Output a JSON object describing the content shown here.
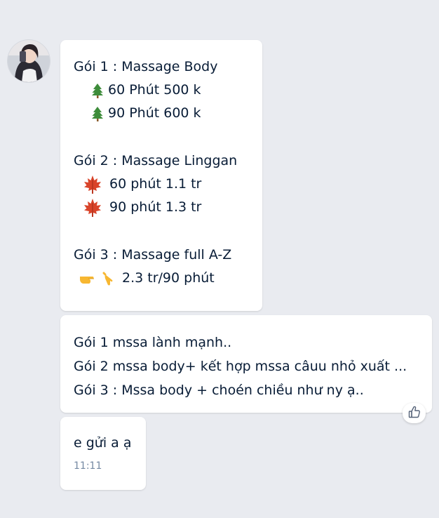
{
  "contact": {
    "avatar_icon": "contact-avatar"
  },
  "messages": [
    {
      "lines": [
        {
          "text": "Gói 1 : Massage Body"
        },
        {
          "icon": "pine-tree-emoji",
          "text": "60 Phút 500 k"
        },
        {
          "icon": "pine-tree-emoji",
          "text": "90 Phút 600 k"
        },
        {
          "text": "Gói 2 : Massage Linggan"
        },
        {
          "icon": "maple-leaf-emoji",
          "text": "60 phút 1.1 tr"
        },
        {
          "icon": "maple-leaf-emoji",
          "text": "90 phút 1.3 tr"
        },
        {
          "text": "Gói 3 : Massage full A-Z"
        },
        {
          "icon": "pointing-hand-emoji",
          "text": "2.3 tr/90 phút"
        }
      ]
    },
    {
      "lines": [
        {
          "text": "Gói 1 mssa lành mạnh.."
        },
        {
          "text": "Gói 2 mssa body+ kết hợp mssa câuu nhỏ xuất ..."
        },
        {
          "text": "Gói 3 : Mssa body + choén chiều như ny ạ.."
        }
      ],
      "reaction_icon": "thumbs-up-icon"
    },
    {
      "text": "e gửi a ạ",
      "time": "11:11"
    }
  ]
}
